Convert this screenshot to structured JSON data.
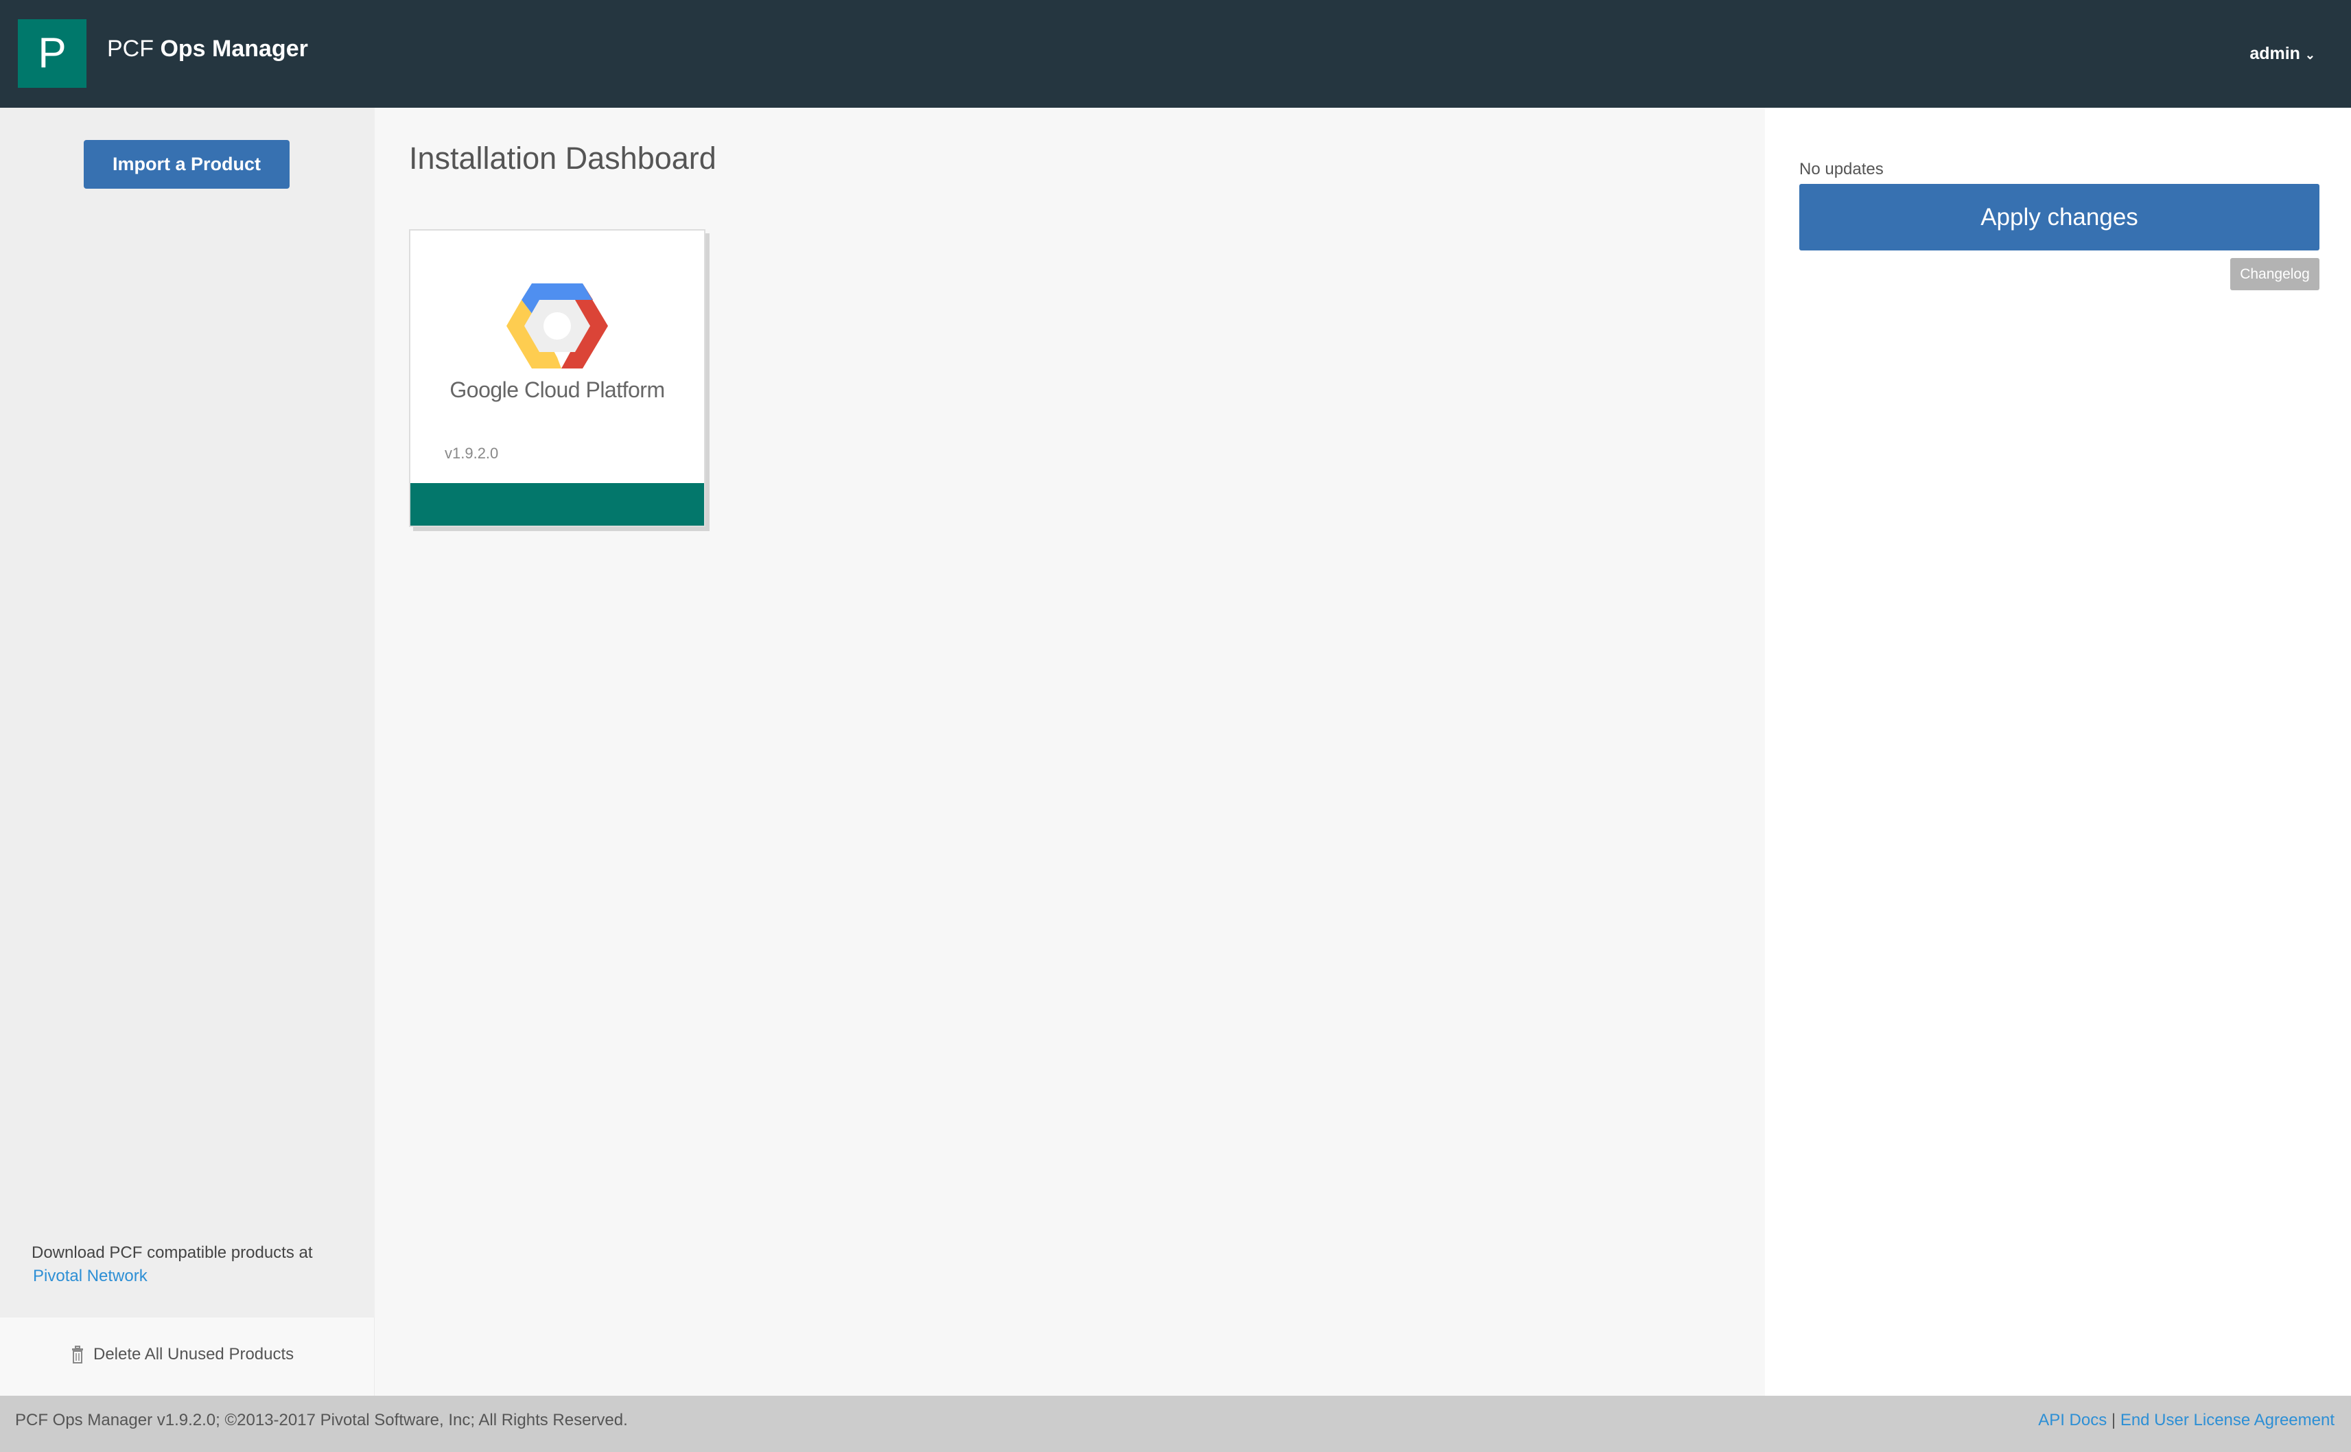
{
  "header": {
    "logo_letter": "P",
    "title_prefix": "PCF",
    "title_main": "Ops Manager",
    "user": "admin"
  },
  "sidebar": {
    "import_label": "Import a Product",
    "download_text": "Download PCF compatible products at",
    "download_link": "Pivotal Network",
    "delete_label": "Delete All Unused Products"
  },
  "main": {
    "title": "Installation Dashboard",
    "products": [
      {
        "name": "Google Cloud Platform",
        "version": "v1.9.2.0",
        "status_color": "#03776b"
      }
    ]
  },
  "right": {
    "status": "No updates",
    "apply_label": "Apply changes",
    "changelog_label": "Changelog"
  },
  "footer": {
    "copyright": "PCF Ops Manager v1.9.2.0; ©2013-2017 Pivotal Software, Inc; All Rights Reserved.",
    "api_docs": "API Docs",
    "separator": "|",
    "eula": "End User License Agreement"
  },
  "colors": {
    "header": "#253640",
    "brand": "#00786b",
    "primary": "#3771b1",
    "link": "#2d8fd5"
  }
}
